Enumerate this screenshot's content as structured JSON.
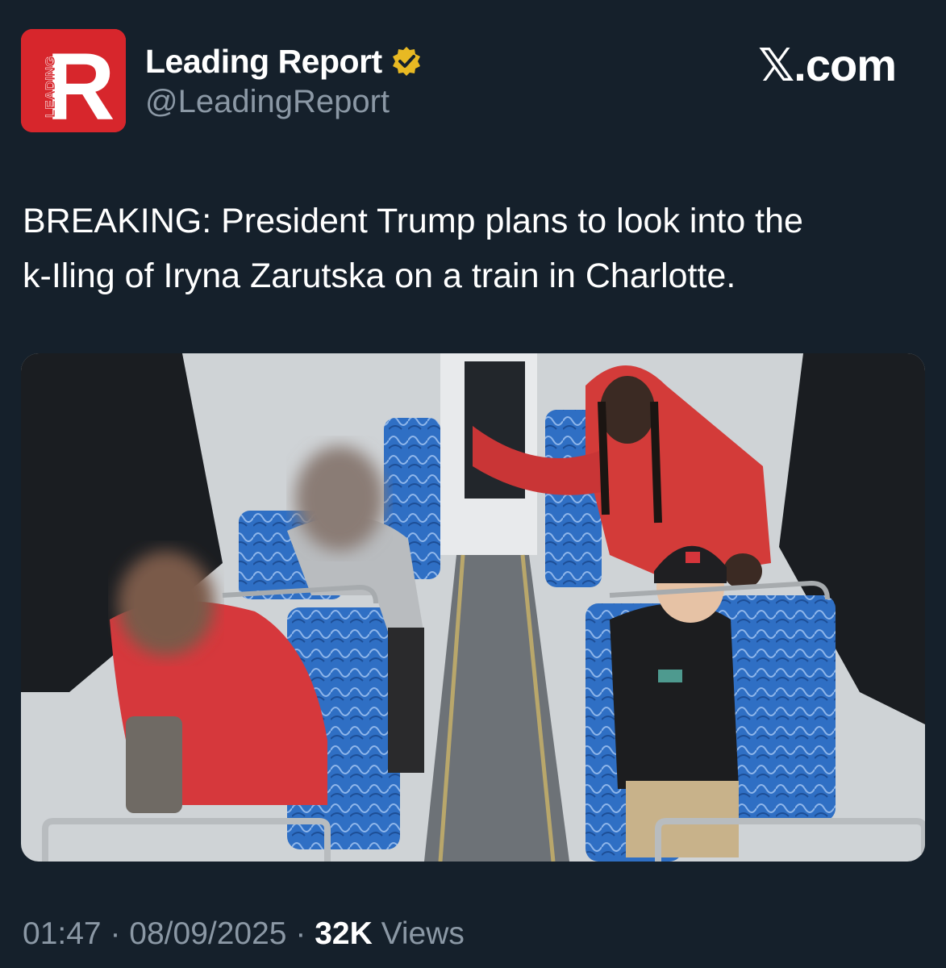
{
  "author": {
    "display_name": "Leading Report",
    "handle": "@LeadingReport",
    "avatar_letter": "R",
    "avatar_small_text": "LEADING",
    "avatar_color": "#d7262c",
    "verified_badge_color": "#e8b923"
  },
  "brand": {
    "label": "𝕏.com"
  },
  "tweet": {
    "line1": "BREAKING: President Trump plans to look into the",
    "line2": "k-Iling of Iryna Zarutska on a train in Charlotte."
  },
  "media": {
    "icon": "photo-icon"
  },
  "footer": {
    "time": "01:47",
    "separator": "·",
    "date": "08/09/2025",
    "views_count": "32K",
    "views_label": "Views"
  },
  "colors": {
    "background": "#15202b",
    "secondary_text": "#8b98a5",
    "primary_text": "#ffffff"
  }
}
